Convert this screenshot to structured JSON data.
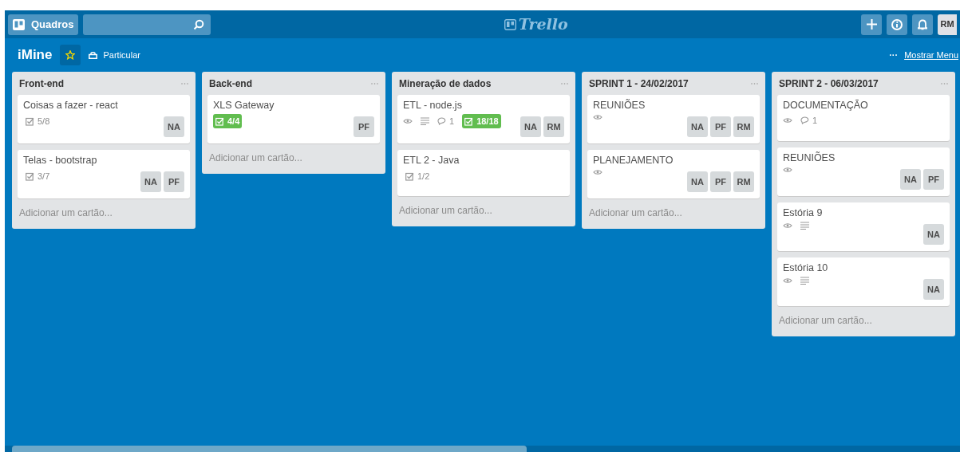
{
  "header": {
    "boards_button": "Quadros",
    "logo": "Trello",
    "avatar": "RM"
  },
  "board": {
    "title": "iMine",
    "starred": true,
    "visibility": "Particular",
    "menu_link": "Mostrar Menu",
    "menu_dots": "···"
  },
  "lists": [
    {
      "title": "Front-end",
      "cards": [
        {
          "title": "Coisas a fazer - react",
          "badges": [
            {
              "kind": "checklist",
              "text": "5/8",
              "complete": false
            }
          ],
          "members": [
            "NA"
          ]
        },
        {
          "title": "Telas - bootstrap",
          "badges": [
            {
              "kind": "checklist",
              "text": "3/7",
              "complete": false
            }
          ],
          "members": [
            "NA",
            "PF"
          ]
        }
      ],
      "add": "Adicionar um cartão..."
    },
    {
      "title": "Back-end",
      "cards": [
        {
          "title": "XLS Gateway",
          "badges": [
            {
              "kind": "checklist",
              "text": "4/4",
              "complete": true
            }
          ],
          "members": [
            "PF"
          ]
        }
      ],
      "add": "Adicionar um cartão..."
    },
    {
      "title": "Mineração de dados",
      "cards": [
        {
          "title": "ETL - node.js",
          "badges": [
            {
              "kind": "watch"
            },
            {
              "kind": "description"
            },
            {
              "kind": "comments",
              "text": "1"
            },
            {
              "kind": "checklist",
              "text": "18/18",
              "complete": true
            }
          ],
          "members": [
            "NA",
            "RM"
          ]
        },
        {
          "title": "ETL 2 - Java",
          "badges": [
            {
              "kind": "checklist",
              "text": "1/2",
              "complete": false
            }
          ]
        }
      ],
      "add": "Adicionar um cartão..."
    },
    {
      "title": "SPRINT 1 - 24/02/2017",
      "cards": [
        {
          "title": "REUNIÕES",
          "badges": [
            {
              "kind": "watch"
            }
          ],
          "members": [
            "NA",
            "PF",
            "RM"
          ]
        },
        {
          "title": "PLANEJAMENTO",
          "badges": [
            {
              "kind": "watch"
            }
          ],
          "members": [
            "NA",
            "PF",
            "RM"
          ]
        }
      ],
      "add": "Adicionar um cartão..."
    },
    {
      "title": "SPRINT 2 - 06/03/2017",
      "cards": [
        {
          "title": "DOCUMENTAÇÃO",
          "badges": [
            {
              "kind": "watch"
            },
            {
              "kind": "comments",
              "text": "1"
            }
          ]
        },
        {
          "title": "REUNIÕES",
          "badges": [
            {
              "kind": "watch"
            }
          ],
          "members": [
            "NA",
            "PF"
          ]
        },
        {
          "title": "Estória 9",
          "badges": [
            {
              "kind": "watch"
            },
            {
              "kind": "description"
            }
          ],
          "members": [
            "NA"
          ]
        },
        {
          "title": "Estória 10",
          "badges": [
            {
              "kind": "watch"
            },
            {
              "kind": "description"
            }
          ],
          "members": [
            "NA"
          ]
        }
      ],
      "add": "Adicionar um cartão..."
    }
  ]
}
